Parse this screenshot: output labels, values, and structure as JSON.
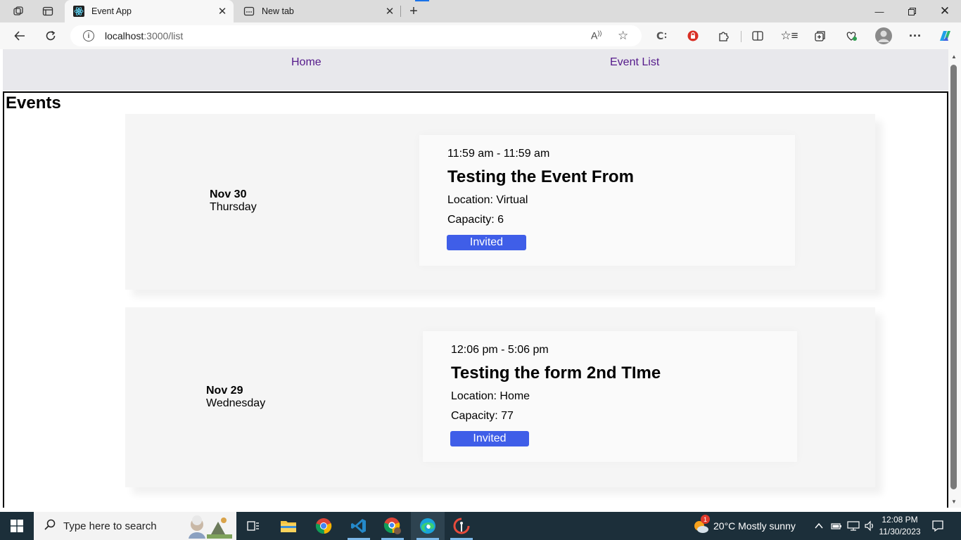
{
  "browser": {
    "tabs": [
      {
        "title": "Event App",
        "active": true
      },
      {
        "title": "New tab",
        "active": false
      }
    ],
    "address": {
      "host": "localhost",
      "rest": ":3000/list"
    }
  },
  "nav": {
    "home": "Home",
    "event_list": "Event List"
  },
  "page": {
    "title": "Events"
  },
  "events": [
    {
      "month_day": "Nov 30",
      "weekday": "Thursday",
      "time": "11:59 am - 11:59 am",
      "name": "Testing the Event From",
      "location": "Location: Virtual",
      "capacity": "Capacity: 6",
      "status": "Invited"
    },
    {
      "month_day": "Nov 29",
      "weekday": "Wednesday",
      "time": "12:06 pm - 5:06 pm",
      "name": "Testing the form 2nd TIme",
      "location": "Location: Home",
      "capacity": "Capacity: 77",
      "status": "Invited"
    }
  ],
  "taskbar": {
    "search_placeholder": "Type here to search",
    "weather": "20°C  Mostly sunny",
    "time": "12:08 PM",
    "date": "11/30/2023",
    "weather_badge": "1"
  },
  "colors": {
    "accent": "#3f5ee8",
    "link": "#551a8b"
  }
}
